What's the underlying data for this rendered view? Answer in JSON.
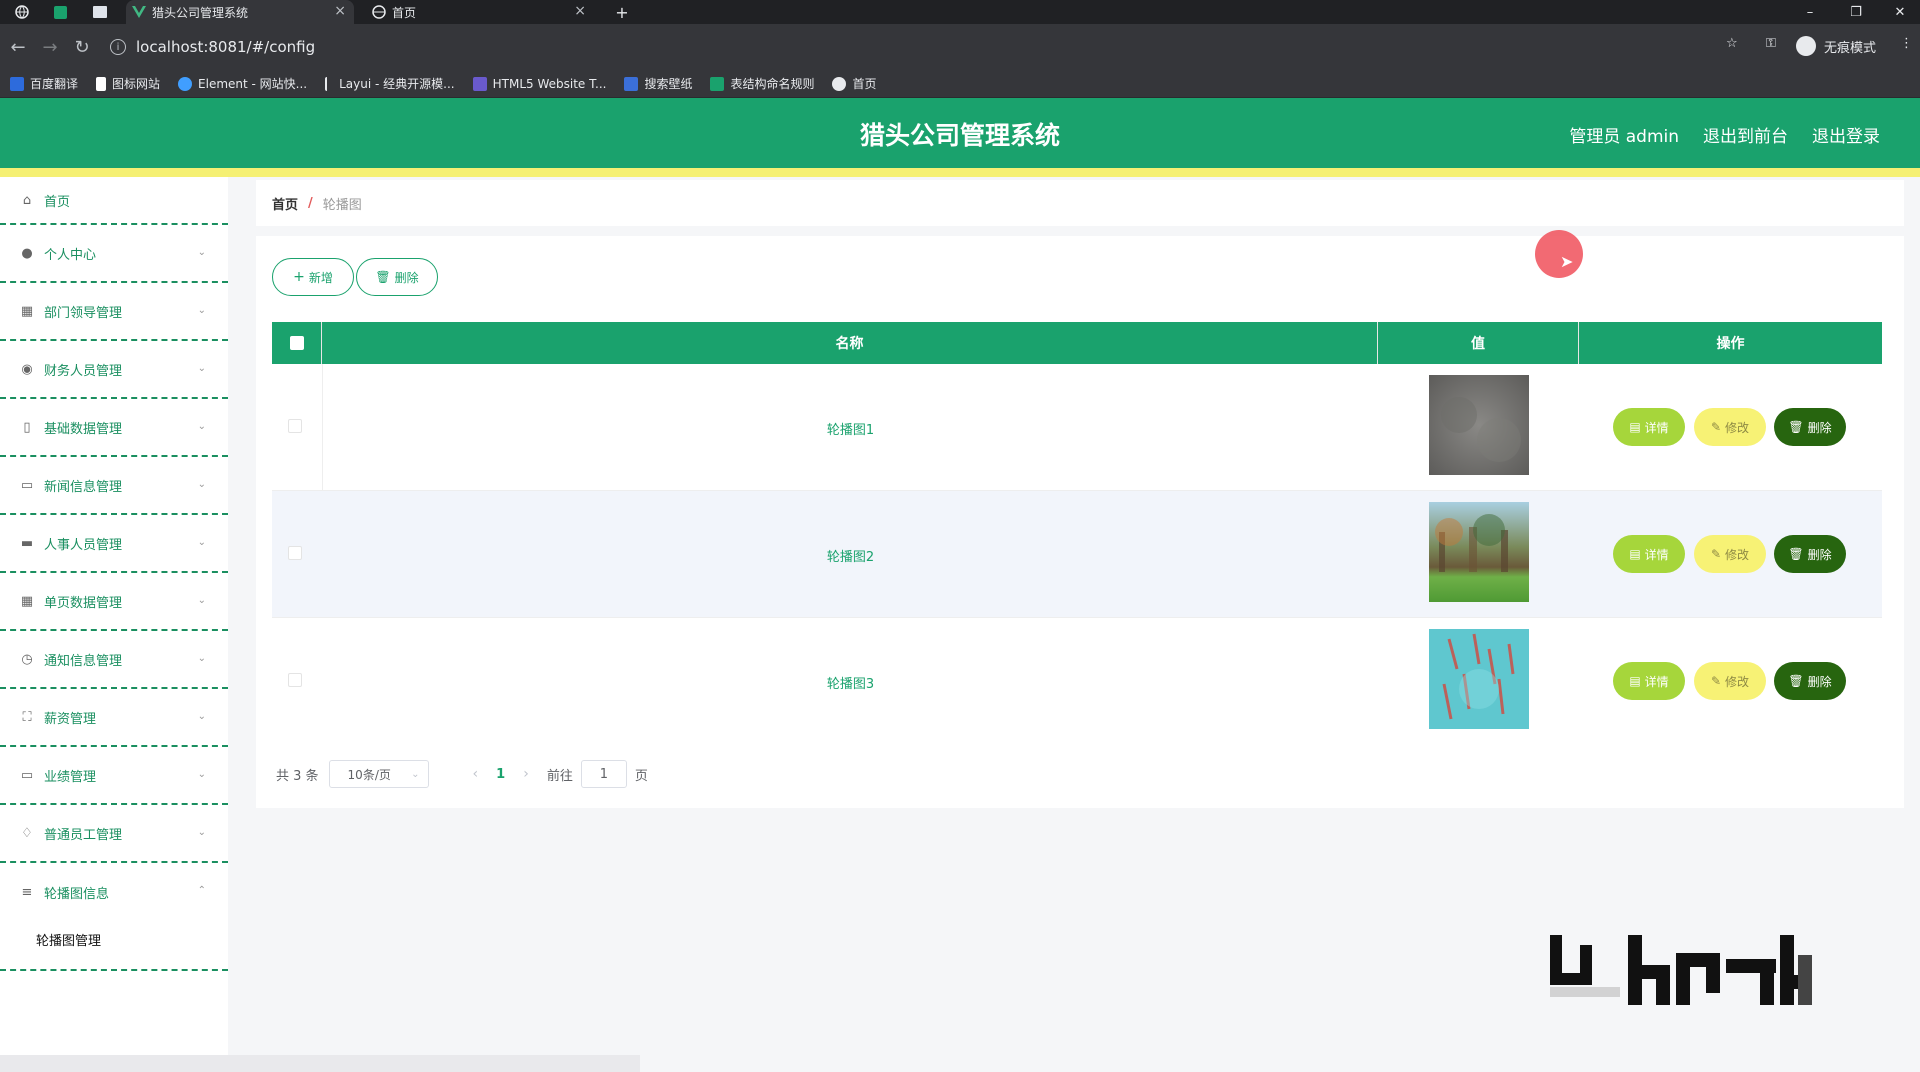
{
  "browser": {
    "tabs": [
      {
        "label": "猎头公司管理系统",
        "active": true
      },
      {
        "label": "首页",
        "active": false
      }
    ],
    "url": "localhost:8081/#/config",
    "incognito_label": "无痕模式",
    "bookmarks": [
      "百度翻译",
      "图标网站",
      "Element - 网站快...",
      "Layui - 经典开源模...",
      "HTML5 Website T...",
      "搜索壁纸",
      "表结构命名规则",
      "首页"
    ]
  },
  "header": {
    "title": "猎头公司管理系统",
    "user": "管理员 admin",
    "to_front": "退出到前台",
    "logout": "退出登录"
  },
  "sidebar": {
    "items": [
      {
        "label": "首页",
        "icon": "home-icon"
      },
      {
        "label": "个人中心",
        "icon": "user-icon"
      },
      {
        "label": "部门领导管理",
        "icon": "grid-icon"
      },
      {
        "label": "财务人员管理",
        "icon": "pin-icon"
      },
      {
        "label": "基础数据管理",
        "icon": "phone-icon"
      },
      {
        "label": "新闻信息管理",
        "icon": "news-icon"
      },
      {
        "label": "人事人员管理",
        "icon": "monitor-icon"
      },
      {
        "label": "单页数据管理",
        "icon": "table-icon"
      },
      {
        "label": "通知信息管理",
        "icon": "clock-icon"
      },
      {
        "label": "薪资管理",
        "icon": "expand-icon"
      },
      {
        "label": "业绩管理",
        "icon": "chat-icon"
      },
      {
        "label": "普通员工管理",
        "icon": "bell-icon"
      },
      {
        "label": "轮播图信息",
        "icon": "menu-icon"
      }
    ],
    "subitem": "轮播图管理"
  },
  "breadcrumb": {
    "home": "首页",
    "separator": "/",
    "current": "轮播图"
  },
  "toolbar": {
    "add": "新增",
    "delete": "删除"
  },
  "table": {
    "headers": {
      "name": "名称",
      "value": "值",
      "actions": "操作"
    },
    "rows": [
      {
        "name": "轮播图1",
        "image": "gray-texture"
      },
      {
        "name": "轮播图2",
        "image": "forest-meadow"
      },
      {
        "name": "轮播图3",
        "image": "teal-red-brush"
      }
    ],
    "actions": {
      "detail": "详情",
      "edit": "修改",
      "delete": "删除"
    }
  },
  "pager": {
    "total": "共 3 条",
    "page_size": "10条/页",
    "current_page": "1",
    "goto_label": "前往",
    "goto_value": "1",
    "page_suffix": "页"
  },
  "colors": {
    "primary": "#1aa26d",
    "accent_bar": "#f5f073",
    "detail": "#a6d63b",
    "edit": "#f7f275",
    "delete": "#27650f"
  }
}
